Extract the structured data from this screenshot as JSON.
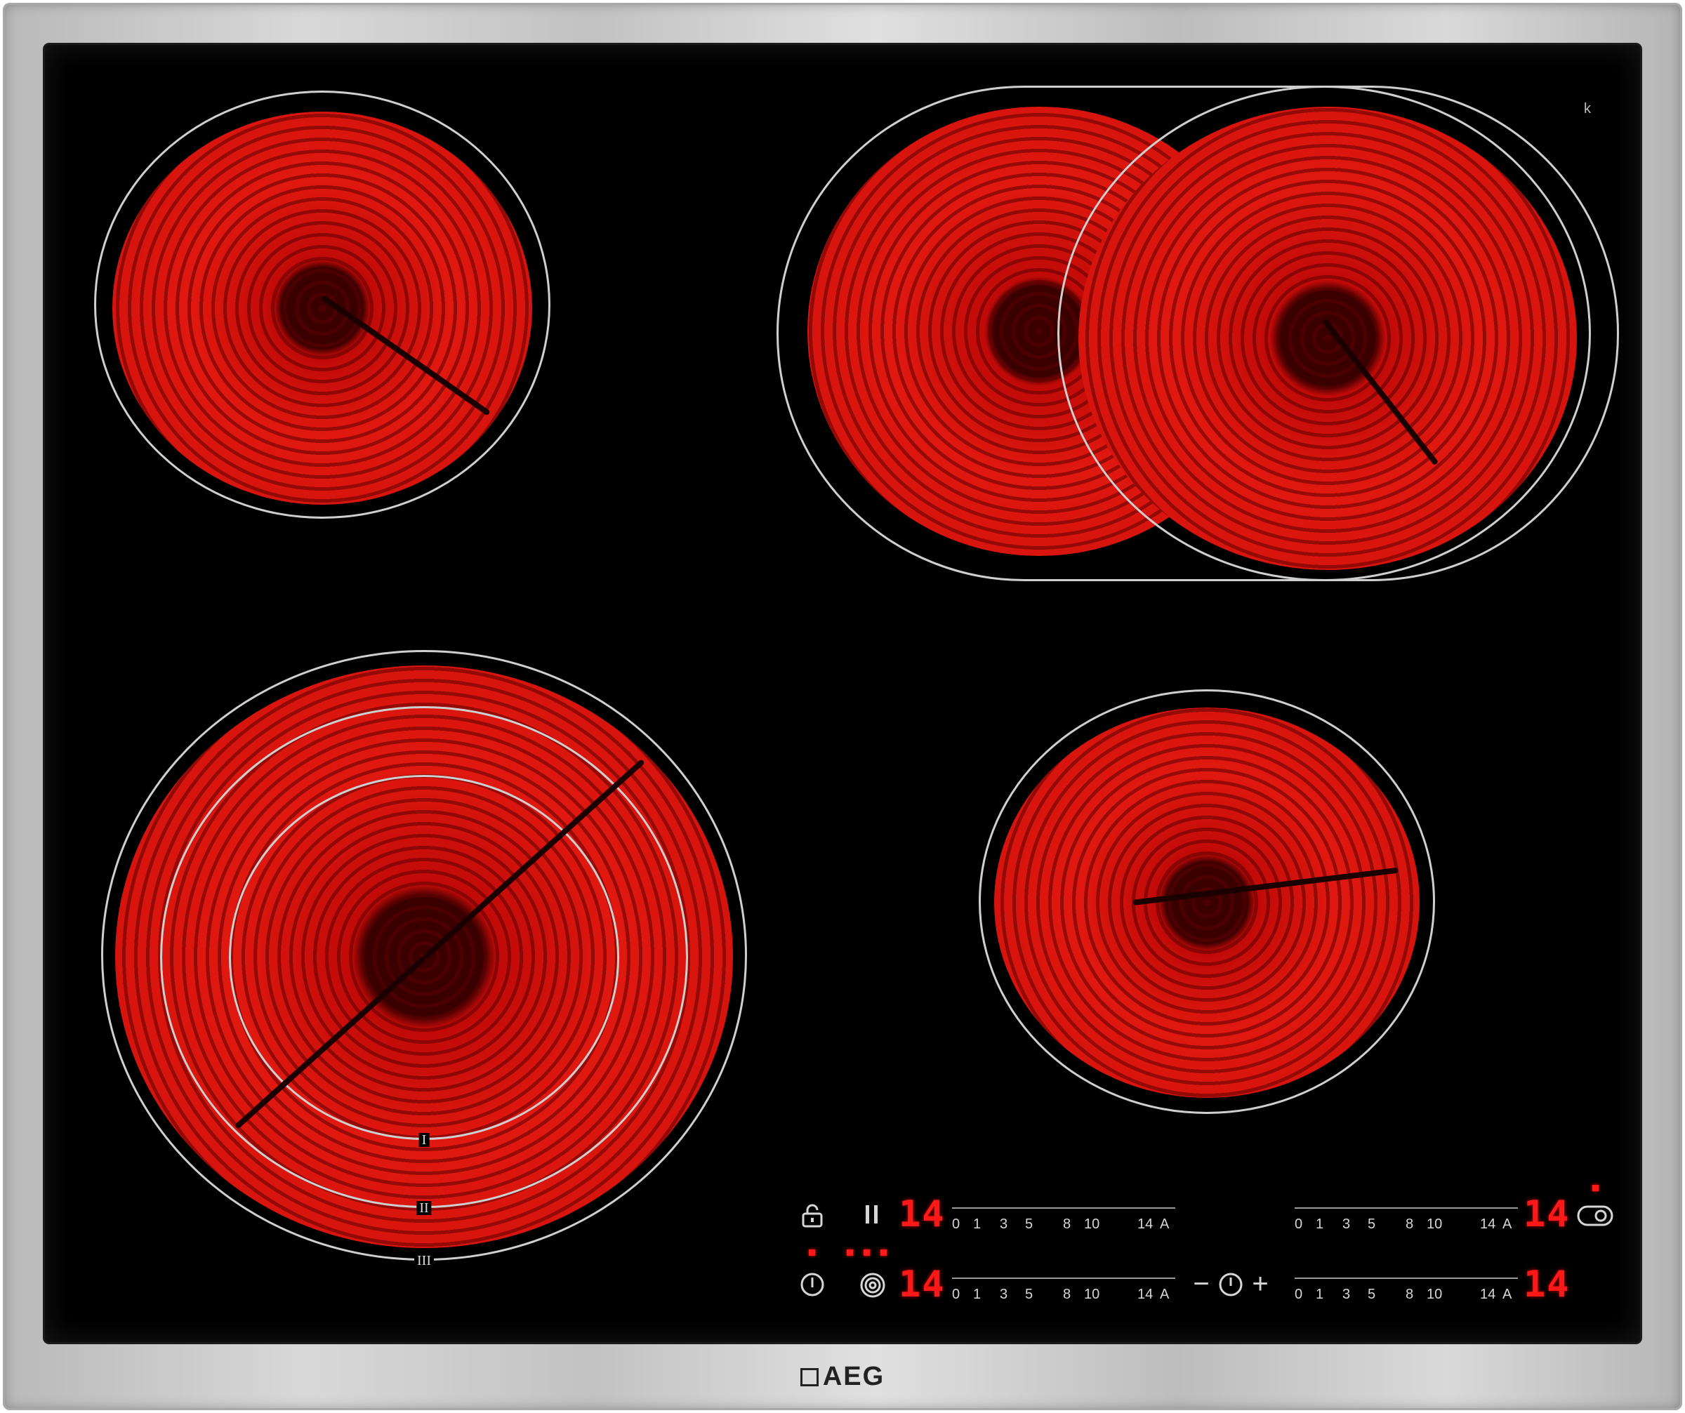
{
  "brand": {
    "logo_text": "AEG",
    "corner_mark": "k"
  },
  "zones": {
    "bottom_left_ring_labels": [
      "I",
      "II",
      "III"
    ]
  },
  "controls": {
    "scale_labels": [
      "0",
      "1",
      "3",
      "5",
      "8",
      "10",
      "14",
      "A"
    ],
    "displays": {
      "front_left": "14",
      "rear_left": "14",
      "rear_right": "14",
      "front_right": "14"
    },
    "icons": {
      "lock": "lock-icon",
      "pause": "pause-icon",
      "power": "power-icon",
      "zone_select": "circle-zone-icon",
      "timer": "timer-icon",
      "bridge": "bridge-icon"
    },
    "timer": {
      "minus": "−",
      "plus": "+"
    }
  },
  "colors": {
    "heat": "#e01810",
    "display": "#ff1818",
    "glass": "#000000",
    "frame": "#c8c8c8"
  }
}
